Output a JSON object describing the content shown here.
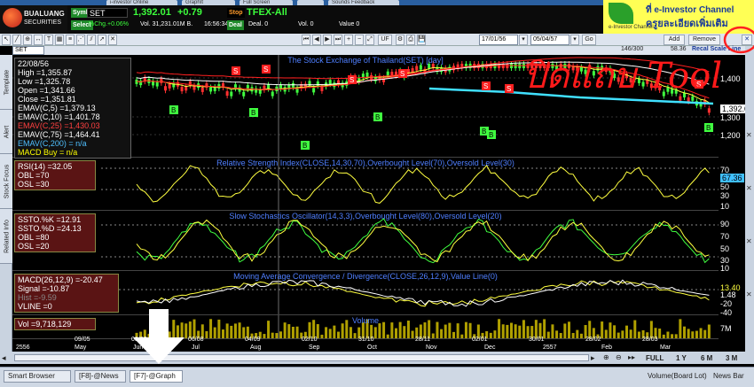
{
  "taskbar_top": {
    "tabs": [
      "i-investor Online",
      "GraphIt",
      "Full Screen",
      "",
      "Sounds Feedback"
    ]
  },
  "header": {
    "logo_line1": "BUALUANG",
    "logo_line2": "SECURITIES",
    "symbol_tag": "Symb",
    "symbol": "SET",
    "price": "1,392.01",
    "change": "+0.79",
    "select_tag": "Select",
    "pct_change": "%Chg.+0.06%",
    "volume_value": "Vol. 31,231.01M B.",
    "time": "16:56:34",
    "stop_tag": "Stop",
    "stop_value": "TFEX-All",
    "deal_tag": "Deal",
    "deal_value": "Deal. 0",
    "vol_label": "Vol. 0",
    "value_label": "Value 0"
  },
  "brand": {
    "line1": "ที่ e-Investor Channel",
    "line2": "ครูยละเอียดเพิ่มเติม",
    "line3": "e-Investor Channel"
  },
  "toolbar": {
    "symbol_input": "SET",
    "period": "UF",
    "date_from": "17/01/56",
    "date_to": "05/04/57",
    "go": "Go",
    "add": "Add",
    "remove": "Remove",
    "range_label": "146/300",
    "ratio_label": "58.36",
    "scale_label": "Recal Scale Line"
  },
  "sidebar": {
    "tabs": [
      "Template",
      "Alert",
      "Stock Focus",
      "Related Info"
    ]
  },
  "price_panel": {
    "title": "The Stock Exchange of Thailand(SET) [day]",
    "info_lines": [
      {
        "text": "22/08/56",
        "color": "#ffffff"
      },
      {
        "text": "High  =1,355.87",
        "color": "#ffffff"
      },
      {
        "text": "Low  =1,325.78",
        "color": "#ffffff"
      },
      {
        "text": "Open  =1,341.66",
        "color": "#ffffff"
      },
      {
        "text": "Close  =1,351.81",
        "color": "#ffffff"
      },
      {
        "text": "EMAV(C,5)  =1,379.13",
        "color": "#ffffff"
      },
      {
        "text": "EMAV(C,10)  =1,401.78",
        "color": "#ffffff"
      },
      {
        "text": "EMAV(C,25)  =1,430.03",
        "color": "#ff4040"
      },
      {
        "text": "EMAV(C,75)  =1,464.41",
        "color": "#ffffff"
      },
      {
        "text": "EMAV(C,200)  = n/a",
        "color": "#4fbfff"
      },
      {
        "text": "MACD Buy  = n/a",
        "color": "#ffff00"
      }
    ],
    "axis_ticks": [
      "1,400",
      "1,300",
      "1,200"
    ],
    "last_label": "1,392.0",
    "buy_marker": "B",
    "sell_marker": "S"
  },
  "rsi_panel": {
    "title": "Relative Strength Index(CLOSE,14,30,70),Overbought Level(70),Oversold Level(30)",
    "info_lines": [
      "RSI(14)   =32.05",
      "OBL   =70",
      "OSL   =30"
    ],
    "axis_ticks": [
      "70",
      "50",
      "30",
      "10"
    ],
    "last_label": "67.36"
  },
  "stoch_panel": {
    "title": "Slow Stochastics Oscillator(14,3,3),Overbought Level(80),Oversold Level(20)",
    "info_lines": [
      "SSTO.%K   =12.91",
      "SSTO.%D   =24.13",
      "OBL   =80",
      "OSL   =20"
    ],
    "axis_ticks": [
      "90",
      "70",
      "50",
      "30",
      "10"
    ]
  },
  "macd_panel": {
    "title": "Moving Average Convergence / Divergence(CLOSE,26,12,9),Value Line(0)",
    "info_lines": [
      {
        "text": "MACD(26,12,9)   =-20.47",
        "color": "#ffffff"
      },
      {
        "text": "Signal  =-10.87",
        "color": "#ffffff"
      },
      {
        "text": "Hist  =-9.59",
        "color": "#888888"
      },
      {
        "text": "VLINE  =0",
        "color": "#ffffff"
      }
    ],
    "axis_ticks": [
      "0",
      "-20",
      "-40"
    ],
    "last_labels": [
      "13.40",
      "1.48"
    ]
  },
  "volume_panel": {
    "title": "Volume",
    "info_line": "Vol   =9,718,129",
    "axis_tick": "7M"
  },
  "xaxis": {
    "dates": [
      "09/05",
      "08/07",
      "06/08",
      "04/09",
      "02/10",
      "31/10",
      "28/11",
      "02/01",
      "30/01",
      "28/02",
      "28/03"
    ],
    "months": [
      "2556",
      "May",
      "Jun",
      "Jul",
      "Aug",
      "Sep",
      "Oct",
      "Nov",
      "Dec",
      "2557",
      "Feb",
      "Mar"
    ]
  },
  "scrollbar": {
    "periods": [
      "FULL",
      "1 Y",
      "6 M",
      "3 M"
    ]
  },
  "bottombar": {
    "tabs": [
      "Smart Browser",
      "[F8]-@News",
      "[F7]-@Graph"
    ],
    "volume_label": "Volume(Board Lot)",
    "news_bar": "News Bar"
  },
  "annotation": {
    "overlay_text": "ปิดแถบ Tool",
    "arrow_color": "#ffffff",
    "circle_color": "#ff2020"
  },
  "colors": {
    "price_line": "#ffffff",
    "ema_red": "#ff2020",
    "ema_cyan": "#40e0ff",
    "osc_yellow": "#ffff40",
    "osc_green": "#40ff40"
  }
}
